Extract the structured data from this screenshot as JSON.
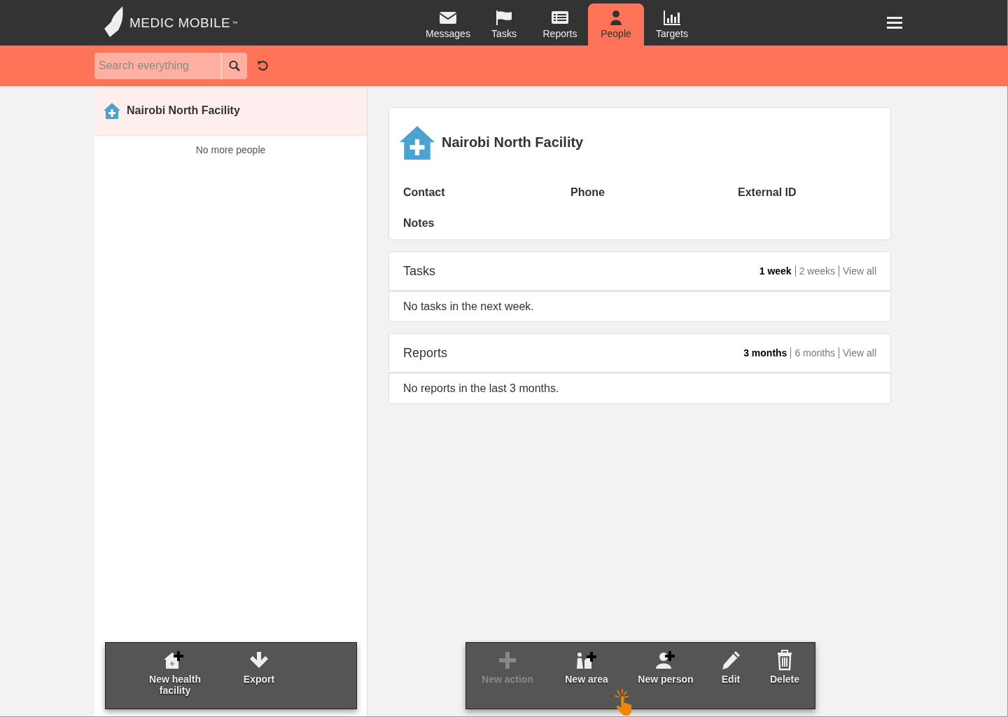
{
  "header": {
    "logo": "MEDIC MOBILE",
    "trademark": "™",
    "tabs": [
      {
        "label": "Messages",
        "kind": "messages",
        "selected": false
      },
      {
        "label": "Tasks",
        "kind": "tasks",
        "selected": false
      },
      {
        "label": "Reports",
        "kind": "reports",
        "selected": false
      },
      {
        "label": "People",
        "kind": "people",
        "selected": true
      },
      {
        "label": "Targets",
        "kind": "targets",
        "selected": false
      }
    ]
  },
  "search": {
    "placeholder": "Search everything"
  },
  "list": {
    "items": [
      {
        "name": "Nairobi North Facility",
        "selected": true
      }
    ],
    "footer": "No more people"
  },
  "detail": {
    "title": "Nairobi North Facility",
    "fields": [
      "Contact",
      "Phone",
      "External ID",
      "Notes"
    ]
  },
  "sections": [
    {
      "title": "Tasks",
      "filters": [
        {
          "label": "1 week",
          "selected": true
        },
        {
          "label": "2 weeks",
          "selected": false
        },
        {
          "label": "View all",
          "selected": false
        }
      ],
      "empty": "No tasks in the next week."
    },
    {
      "title": "Reports",
      "filters": [
        {
          "label": "3 months",
          "selected": true
        },
        {
          "label": "6 months",
          "selected": false
        },
        {
          "label": "View all",
          "selected": false
        }
      ],
      "empty": "No reports in the last 3 months."
    }
  ],
  "left_actions": [
    {
      "label": "New health facility",
      "kind": "facility",
      "disabled": false
    },
    {
      "label": "Export",
      "kind": "export",
      "disabled": false
    }
  ],
  "right_actions": [
    {
      "label": "New action",
      "kind": "plus",
      "disabled": true
    },
    {
      "label": "New area",
      "kind": "area",
      "disabled": false
    },
    {
      "label": "New person",
      "kind": "person",
      "disabled": false
    },
    {
      "label": "Edit",
      "kind": "edit",
      "disabled": false
    },
    {
      "label": "Delete",
      "kind": "delete",
      "disabled": false
    }
  ]
}
